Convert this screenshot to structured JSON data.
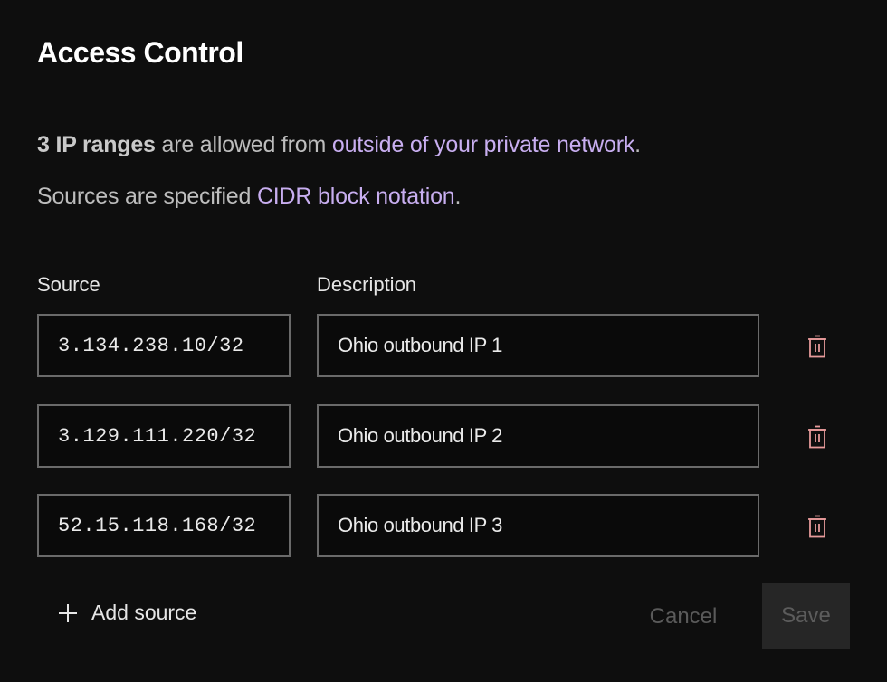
{
  "header": {
    "title": "Access Control"
  },
  "summary": {
    "count_text": "3 IP ranges",
    "middle_text": " are allowed from ",
    "network_link": "outside of your private network",
    "period1": ".",
    "sources_prefix": "Sources are specified ",
    "cidr_link": "CIDR block notation",
    "period2": "."
  },
  "columns": {
    "source": "Source",
    "description": "Description"
  },
  "rows": [
    {
      "source": "3.134.238.10/32",
      "description": "Ohio outbound IP 1"
    },
    {
      "source": "3.129.111.220/32",
      "description": "Ohio outbound IP 2"
    },
    {
      "source": "52.15.118.168/32",
      "description": "Ohio outbound IP 3"
    }
  ],
  "icons": {
    "delete": "trash-icon",
    "add": "plus-icon"
  },
  "actions": {
    "add_source": "Add source",
    "cancel": "Cancel",
    "save": "Save"
  },
  "colors": {
    "background": "#0e0e0e",
    "link": "#c8aef0",
    "delete_icon": "#e79a9a",
    "field_border": "#6a6a6a",
    "save_disabled_bg": "#262626"
  }
}
